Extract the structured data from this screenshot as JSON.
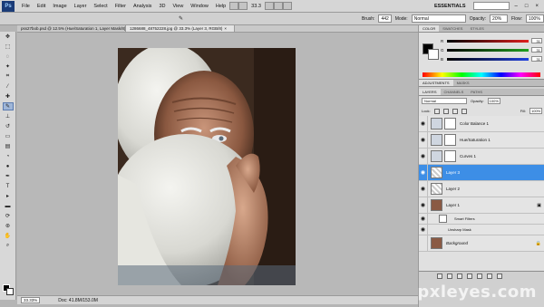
{
  "menubar": {
    "logo": "Ps",
    "items": [
      "File",
      "Edit",
      "Image",
      "Layer",
      "Select",
      "Filter",
      "Analysis",
      "3D",
      "View",
      "Window",
      "Help"
    ],
    "zoom": "33.3",
    "workspace": "ESSENTIALS"
  },
  "options": {
    "brush_label": "Brush:",
    "brush_size": "442",
    "mode_label": "Mode:",
    "mode_value": "Normal",
    "opacity_label": "Opacity:",
    "opacity_value": "20%",
    "flow_label": "Flow:",
    "flow_value": "100%"
  },
  "doctabs": [
    {
      "label": "pss27bob.psd @ 12.5% (Hue/Saturation 1, Layer Mask/8)"
    },
    {
      "label": "1286688_48752228.jpg @ 33.3% (Layer 3, RGB/8)"
    }
  ],
  "status": {
    "zoom": "33.33%",
    "doc": "Doc: 41.8M/153.0M"
  },
  "color_panel": {
    "tabs": [
      "COLOR",
      "SWATCHES",
      "STYLES"
    ],
    "sliders": [
      {
        "label": "R",
        "value": "31",
        "color": "#e02020"
      },
      {
        "label": "G",
        "value": "31",
        "color": "#20a020"
      },
      {
        "label": "B",
        "value": "31",
        "color": "#2040e0"
      }
    ]
  },
  "adjustments": {
    "tabs": [
      "ADJUSTMENTS",
      "MASKS"
    ]
  },
  "layers_panel": {
    "tabs": [
      "LAYERS",
      "CHANNELS",
      "PATHS"
    ],
    "blend_mode": "Normal",
    "opacity_label": "Opacity:",
    "opacity": "100%",
    "lock_label": "Lock:",
    "fill_label": "Fill:",
    "fill": "100%",
    "layers": [
      {
        "name": "Color Balance 1"
      },
      {
        "name": "Hue/Saturation 1"
      },
      {
        "name": "Curves 1"
      },
      {
        "name": "Layer 3"
      },
      {
        "name": "Layer 2"
      },
      {
        "name": "Layer 1"
      }
    ],
    "smart_filters": "Smart Filters",
    "unsharp_mask": "Unsharp Mask",
    "background": "Background"
  },
  "watermark": "pxleyes.com"
}
